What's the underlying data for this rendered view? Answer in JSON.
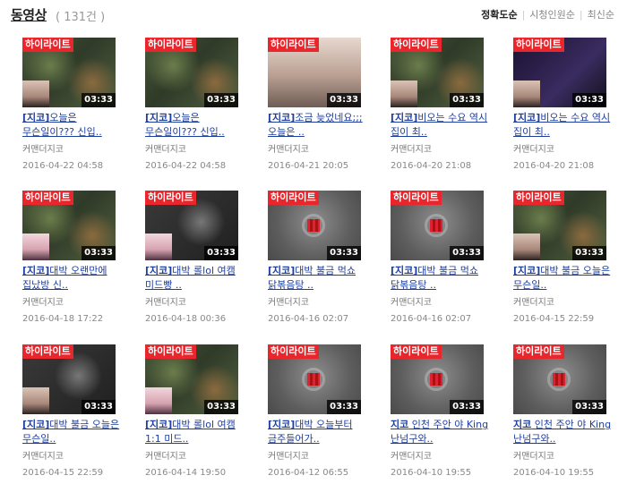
{
  "header": {
    "title": "동영상",
    "count": "( 131건 )",
    "sort": [
      "정확도순",
      "시청인원순",
      "최신순"
    ],
    "active_sort": "정확도순"
  },
  "badge_label": "하이라이트",
  "videos": [
    {
      "thumb": "game",
      "cam": "person",
      "duration": "03:33",
      "prefix": "[지코]",
      "title": "오늘은 무슨일이??? 신입..",
      "channel": "커맨더지코",
      "date": "2016-04-22 04:58"
    },
    {
      "thumb": "game",
      "cam": "none",
      "duration": "03:33",
      "prefix": "[지코]",
      "title": "오늘은 무슨일이??? 신입..",
      "channel": "커맨더지코",
      "date": "2016-04-22 04:58"
    },
    {
      "thumb": "room",
      "cam": "none",
      "duration": "03:33",
      "prefix": "[지코]",
      "title": "조금 늦었네요;;; 오늘은 ..",
      "channel": "커맨더지코",
      "date": "2016-04-21 20:05"
    },
    {
      "thumb": "game",
      "cam": "person",
      "duration": "03:33",
      "prefix": "[지코]",
      "title": "비오는 수요 역시 집이 최..",
      "channel": "커맨더지코",
      "date": "2016-04-20 21:08"
    },
    {
      "thumb": "screen",
      "cam": "person",
      "duration": "03:33",
      "prefix": "[지코]",
      "title": "비오는 수요 역시 집이 최..",
      "channel": "커맨더지코",
      "date": "2016-04-20 21:08"
    },
    {
      "thumb": "game",
      "cam": "pink",
      "duration": "03:33",
      "prefix": "[지코]",
      "title": "대박 오랜만에 집났방 신..",
      "channel": "커맨더지코",
      "date": "2016-04-18 17:22"
    },
    {
      "thumb": "dark",
      "cam": "pink",
      "duration": "03:33",
      "prefix": "[지코]",
      "title": "대박 롤lol 여캠 미드빵 ..",
      "channel": "커맨더지코",
      "date": "2016-04-18 00:36"
    },
    {
      "thumb": "blur",
      "cam": "none",
      "duration": "03:33",
      "prefix": "[지코]",
      "title": "대박 불금 먹쇼 닭볶음탕 ..",
      "channel": "커맨더지코",
      "date": "2016-04-16 02:07"
    },
    {
      "thumb": "blur",
      "cam": "none",
      "duration": "03:33",
      "prefix": "[지코]",
      "title": "대박 불금 먹쇼 닭볶음탕 ..",
      "channel": "커맨더지코",
      "date": "2016-04-16 02:07"
    },
    {
      "thumb": "game",
      "cam": "person",
      "duration": "03:33",
      "prefix": "[지코]",
      "title": "대박 불금 오늘은 무슨일..",
      "channel": "커맨더지코",
      "date": "2016-04-15 22:59"
    },
    {
      "thumb": "dark",
      "cam": "person",
      "duration": "03:33",
      "prefix": "[지코]",
      "title": "대박 불금 오늘은 무슨일..",
      "channel": "커맨더지코",
      "date": "2016-04-15 22:59"
    },
    {
      "thumb": "game",
      "cam": "pink",
      "duration": "03:33",
      "prefix": "[지코]",
      "title": "대박 롤lol 여캠 1:1 미드..",
      "channel": "커맨더지코",
      "date": "2016-04-14 19:50"
    },
    {
      "thumb": "blur",
      "cam": "none",
      "duration": "03:33",
      "prefix": "[지코]",
      "title": "대박 오늘부터 금주들어가..",
      "channel": "커맨더지코",
      "date": "2016-04-12 06:55"
    },
    {
      "thumb": "blur",
      "cam": "none",
      "duration": "03:33",
      "prefix": "지코",
      "title": " 인천 주안 야 King 난넘구와..",
      "channel": "커맨더지코",
      "date": "2016-04-10 19:55"
    },
    {
      "thumb": "blur",
      "cam": "none",
      "duration": "03:33",
      "prefix": "지코",
      "title": " 인천 주안 야 King 난넘구와..",
      "channel": "커맨더지코",
      "date": "2016-04-10 19:55"
    }
  ]
}
